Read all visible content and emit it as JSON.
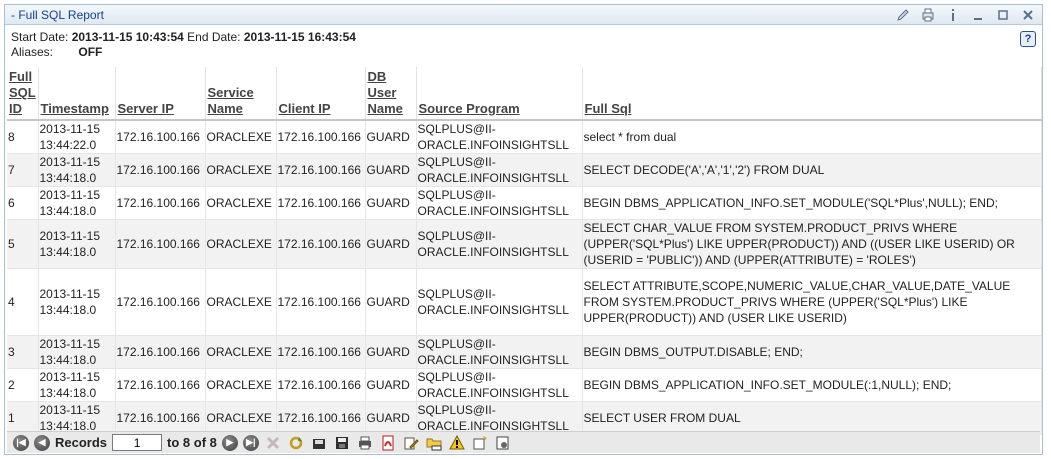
{
  "window": {
    "title": "- Full SQL Report"
  },
  "meta": {
    "start_label": "Start Date:",
    "start_value": "2013-11-15 10:43:54",
    "end_label": "End Date:",
    "end_value": "2013-11-15 16:43:54",
    "aliases_label": "Aliases:",
    "aliases_value": "OFF"
  },
  "columns": [
    "Full SQL ID",
    "Timestamp",
    "Server IP",
    "Service Name",
    "Client IP",
    "DB User Name",
    "Source Program",
    "Full Sql"
  ],
  "rows": [
    {
      "id": "8",
      "ts": "2013-11-15 13:44:22.0",
      "server": "172.16.100.166",
      "service": "ORACLEXE",
      "client": "172.16.100.166",
      "user": "GUARD",
      "program": "SQLPLUS@II-ORACLE.INFOINSIGHTSLL",
      "sql": "select * from dual"
    },
    {
      "id": "7",
      "ts": "2013-11-15 13:44:18.0",
      "server": "172.16.100.166",
      "service": "ORACLEXE",
      "client": "172.16.100.166",
      "user": "GUARD",
      "program": "SQLPLUS@II-ORACLE.INFOINSIGHTSLL",
      "sql": "SELECT DECODE('A','A','1','2') FROM DUAL"
    },
    {
      "id": "6",
      "ts": "2013-11-15 13:44:18.0",
      "server": "172.16.100.166",
      "service": "ORACLEXE",
      "client": "172.16.100.166",
      "user": "GUARD",
      "program": "SQLPLUS@II-ORACLE.INFOINSIGHTSLL",
      "sql": "BEGIN DBMS_APPLICATION_INFO.SET_MODULE('SQL*Plus',NULL); END;"
    },
    {
      "id": "5",
      "ts": "2013-11-15 13:44:18.0",
      "server": "172.16.100.166",
      "service": "ORACLEXE",
      "client": "172.16.100.166",
      "user": "GUARD",
      "program": "SQLPLUS@II-ORACLE.INFOINSIGHTSLL",
      "sql": "SELECT CHAR_VALUE FROM SYSTEM.PRODUCT_PRIVS WHERE (UPPER('SQL*Plus') LIKE UPPER(PRODUCT)) AND ((USER LIKE USERID) OR (USERID = 'PUBLIC')) AND (UPPER(ATTRIBUTE) = 'ROLES')"
    },
    {
      "id": "4",
      "ts": "2013-11-15 13:44:18.0",
      "server": "172.16.100.166",
      "service": "ORACLEXE",
      "client": "172.16.100.166",
      "user": "GUARD",
      "program": "SQLPLUS@II-ORACLE.INFOINSIGHTSLL",
      "sql": "SELECT ATTRIBUTE,SCOPE,NUMERIC_VALUE,CHAR_VALUE,DATE_VALUE FROM SYSTEM.PRODUCT_PRIVS WHERE (UPPER('SQL*Plus') LIKE UPPER(PRODUCT)) AND (USER LIKE USERID)"
    },
    {
      "id": "3",
      "ts": "2013-11-15 13:44:18.0",
      "server": "172.16.100.166",
      "service": "ORACLEXE",
      "client": "172.16.100.166",
      "user": "GUARD",
      "program": "SQLPLUS@II-ORACLE.INFOINSIGHTSLL",
      "sql": "BEGIN DBMS_OUTPUT.DISABLE; END;"
    },
    {
      "id": "2",
      "ts": "2013-11-15 13:44:18.0",
      "server": "172.16.100.166",
      "service": "ORACLEXE",
      "client": "172.16.100.166",
      "user": "GUARD",
      "program": "SQLPLUS@II-ORACLE.INFOINSIGHTSLL",
      "sql": "BEGIN DBMS_APPLICATION_INFO.SET_MODULE(:1,NULL); END;"
    },
    {
      "id": "1",
      "ts": "2013-11-15 13:44:18.0",
      "server": "172.16.100.166",
      "service": "ORACLEXE",
      "client": "172.16.100.166",
      "user": "GUARD",
      "program": "SQLPLUS@II-ORACLE.INFOINSIGHTSLL",
      "sql": "SELECT USER FROM DUAL"
    }
  ],
  "footer": {
    "records_label": "Records",
    "page_value": "1",
    "of_text": "to 8 of 8"
  },
  "icons": {
    "title_tools": [
      "edit-icon",
      "print-icon",
      "info-icon",
      "minimize-icon",
      "maximize-icon",
      "close-icon"
    ],
    "accent": "#15428b"
  }
}
